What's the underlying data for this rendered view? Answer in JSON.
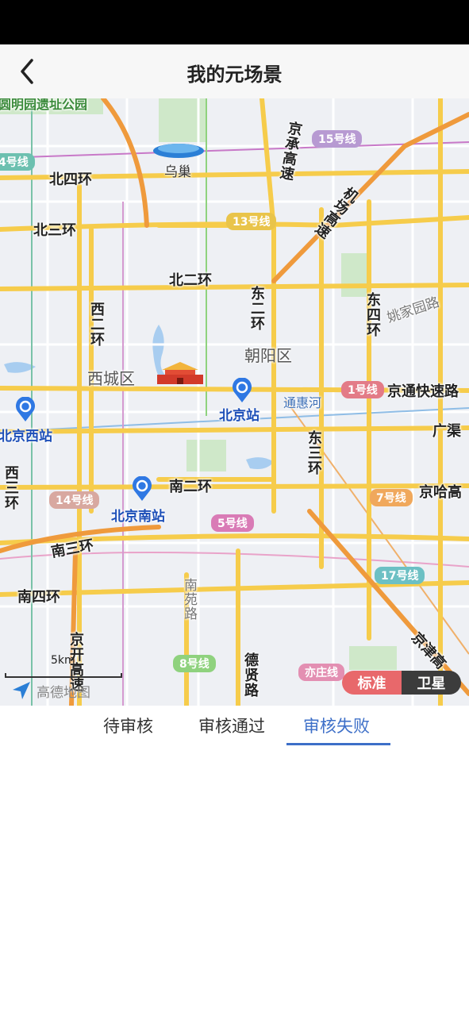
{
  "header": {
    "title": "我的元场景"
  },
  "map": {
    "districts": [
      "西城区",
      "朝阳区"
    ],
    "roads_h": [
      "北四环",
      "北三环",
      "北二环",
      "南二环",
      "南三环",
      "南四环"
    ],
    "roads_v": [
      "西二环",
      "东二环",
      "东三环",
      "东四环",
      "京承高速",
      "机场高速",
      "南苑路",
      "德贤路",
      "京开高速",
      "西三环"
    ],
    "roads_other": [
      "姚家园路",
      "京通快速路",
      "广渠",
      "京哈高",
      "京津高"
    ],
    "pois": [
      "乌巢",
      "通惠河",
      "圆明园遗址公园"
    ],
    "stations": [
      "北京站",
      "北京西站",
      "北京南站"
    ],
    "metro": [
      "15号线",
      "13号线",
      "14号线",
      "1号线",
      "5号线",
      "7号线",
      "17号线",
      "8号线",
      "亦庄线",
      "4号线"
    ],
    "scale_label": "5km",
    "logo_text": "高德地图",
    "toggle": {
      "standard": "标准",
      "satellite": "卫星"
    }
  },
  "tabs": [
    "待审核",
    "审核通过",
    "审核失败"
  ],
  "active_tab": "审核失败",
  "colors": {
    "accent": "#3d6fc8",
    "toggle_active": "#e8686b",
    "toggle_inactive": "#3c3c3c"
  }
}
